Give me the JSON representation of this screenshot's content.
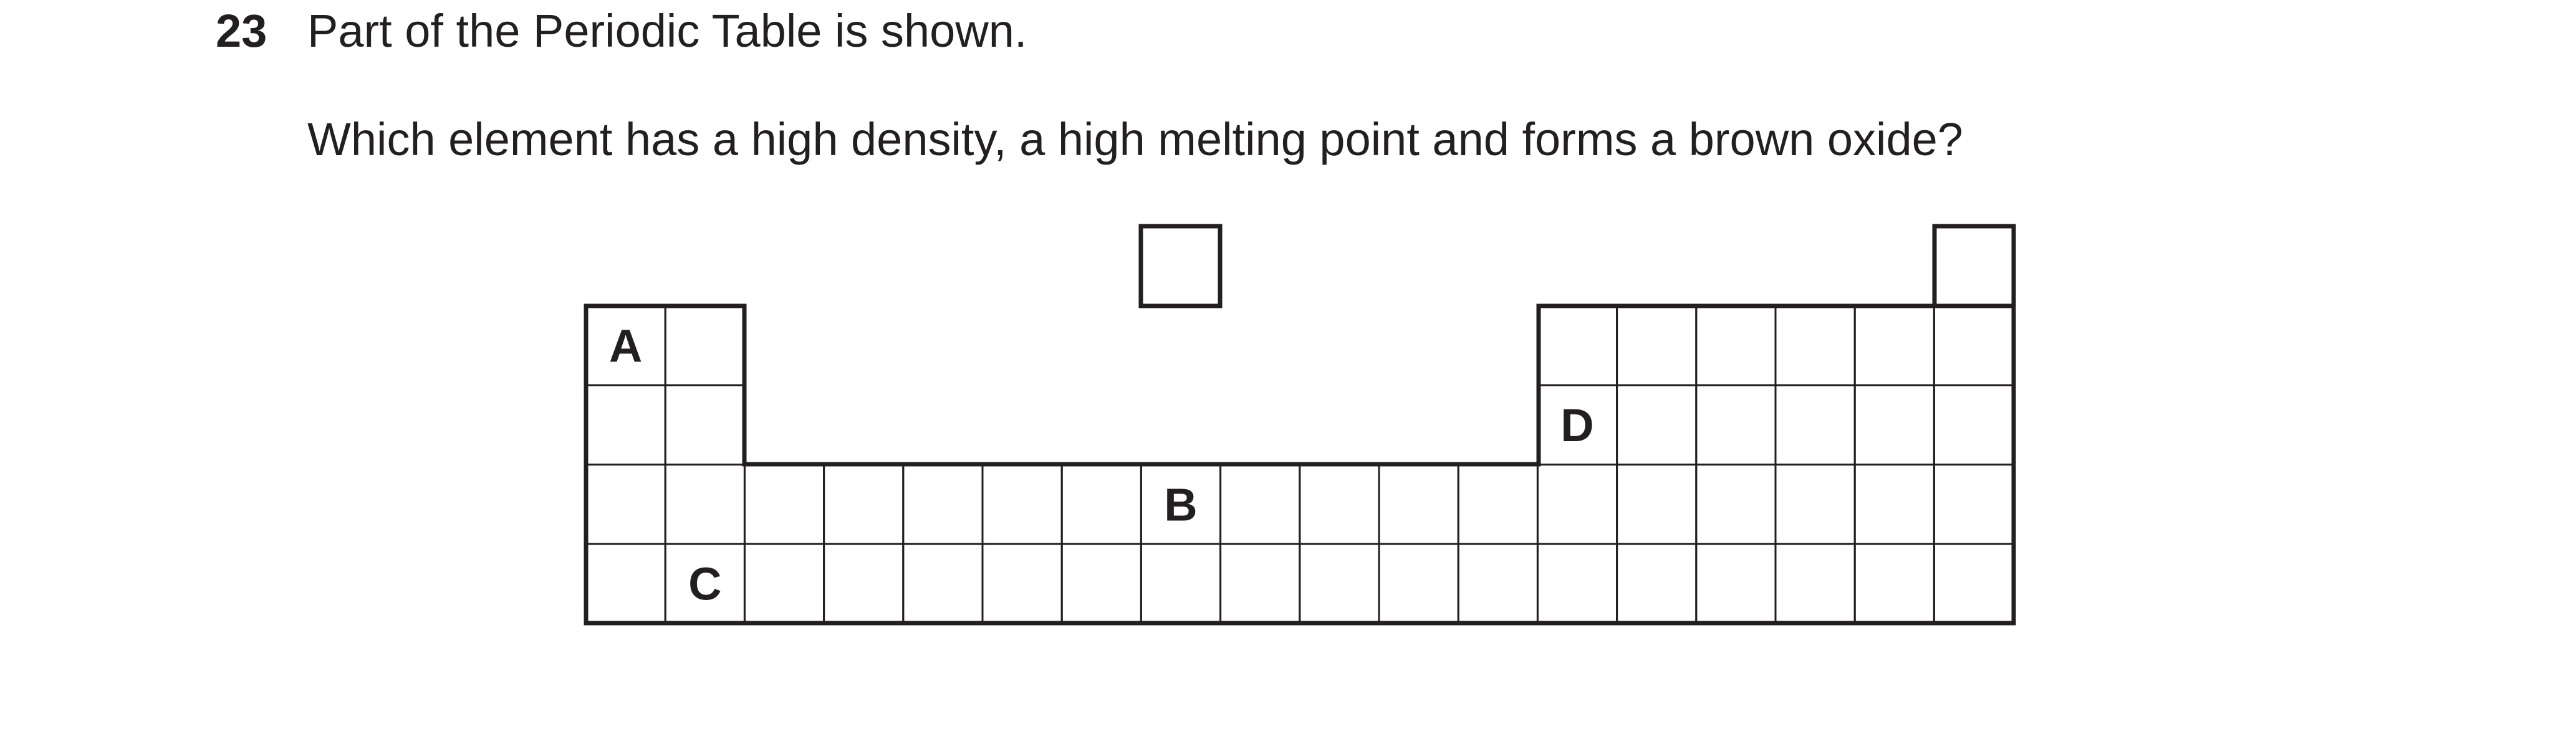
{
  "question": {
    "number": "23",
    "stem": "Part of the Periodic Table is shown.",
    "prompt": "Which element has a high density, a high melting point and forms a brown oxide?"
  },
  "periodic_table": {
    "labels": [
      {
        "letter": "A",
        "row": 0,
        "col": 0
      },
      {
        "letter": "D",
        "row": 1,
        "col": 12
      },
      {
        "letter": "B",
        "row": 2,
        "col": 7
      },
      {
        "letter": "C",
        "row": 3,
        "col": 1
      }
    ]
  }
}
